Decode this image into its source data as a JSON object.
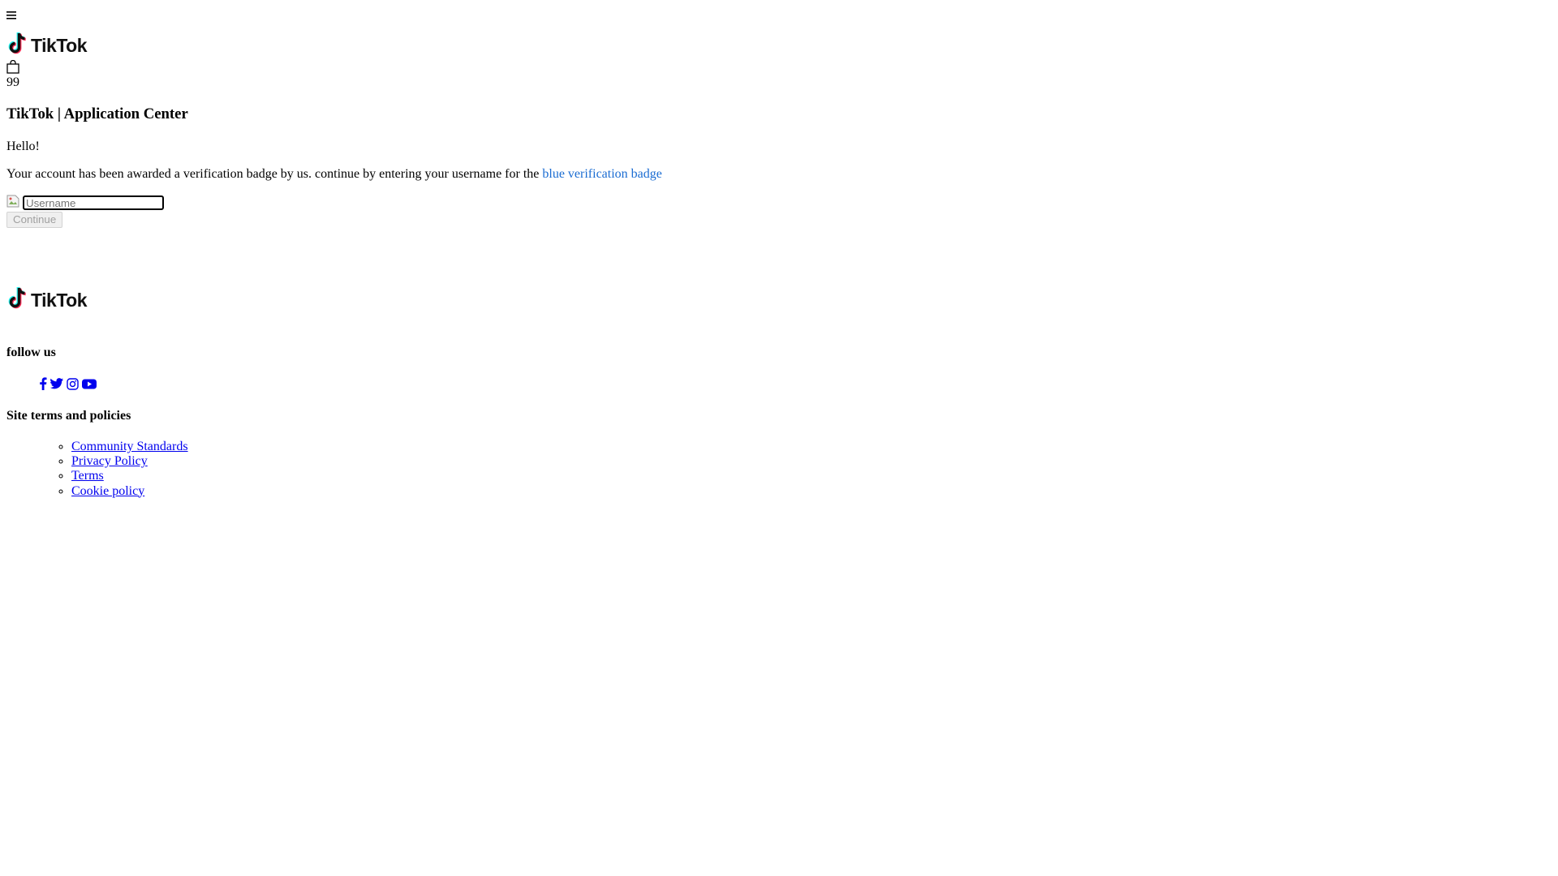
{
  "header": {
    "menu_icon": "hamburger-menu-icon",
    "logo_text": "TikTok",
    "cart_icon": "shopping-bag-icon",
    "cart_count": "99"
  },
  "main": {
    "title": "TikTok | Application Center",
    "greeting": "Hello!",
    "message": "Your account has been awarded a verification badge by us. continue by entering your username for the ",
    "message_highlight": "blue verification badge",
    "highlight_color": "#1a6cd2",
    "username_placeholder": "Username",
    "username_value": "",
    "continue_label": "Continue"
  },
  "footer": {
    "logo_text": "TikTok",
    "follow_heading": "follow us",
    "social_icons": [
      "facebook-icon",
      "twitter-icon",
      "instagram-icon",
      "youtube-icon"
    ],
    "social_color": "#0000ee",
    "terms_heading": "Site terms and policies",
    "links": [
      {
        "label": "Community Standards"
      },
      {
        "label": "Privacy Policy"
      },
      {
        "label": "Terms"
      },
      {
        "label": "Cookie policy"
      }
    ]
  }
}
